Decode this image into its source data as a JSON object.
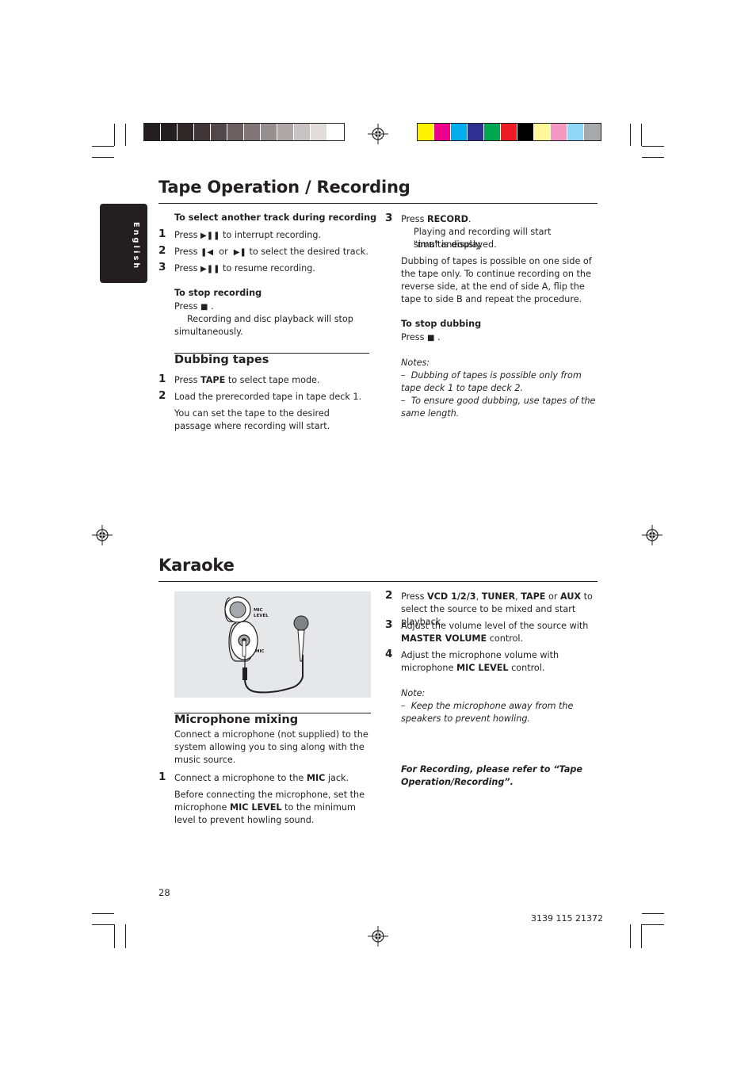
{
  "printer_marks": {
    "grayscale_swatches": [
      "#231f20",
      "#231f20",
      "#2e2627",
      "#3f3637",
      "#524849",
      "#6a6061",
      "#807677",
      "#978e8f",
      "#b0a7a8",
      "#c9c2c3",
      "#e2dddd",
      "#ffffff"
    ],
    "color_swatches": [
      "#fff200",
      "#ec008c",
      "#00aeef",
      "#2e3192",
      "#00a651",
      "#ed1c24",
      "#000000",
      "#fff799",
      "#f49ac1",
      "#8fd8f8",
      "#a7a9ac"
    ]
  },
  "sidebar": {
    "language_tab": "English"
  },
  "tape_section": {
    "title": "Tape Operation / Recording",
    "select_track": {
      "heading": "To select another track during recording",
      "steps": [
        {
          "num": "1",
          "pre": "Press",
          "icon": "play-pause",
          "post": "to interrupt recording."
        },
        {
          "num": "2",
          "pre": "Press",
          "icon1": "previous",
          "mid": "or",
          "icon2": "next",
          "post": "to select the desired track."
        },
        {
          "num": "3",
          "pre": "Press",
          "icon": "play-pause",
          "post": "to resume recording."
        }
      ]
    },
    "stop_recording": {
      "heading": "To stop recording",
      "press": "Press",
      "icon": "stop",
      "result": "Recording and disc playback will stop simultaneously."
    },
    "dubbing": {
      "heading": "Dubbing tapes",
      "step1": {
        "num": "1",
        "pre": "Press",
        "key": "TAPE",
        "post": "to select tape mode."
      },
      "step2": {
        "num": "2",
        "text": "Load the prerecorded tape in tape deck 1.",
        "extra": "You can set the tape to the desired passage where recording will start."
      }
    },
    "right_col": {
      "step3": {
        "num": "3",
        "pre": "Press",
        "key": "RECORD",
        "post": ".",
        "line2": "Playing and recording will start simultaneously.",
        "display_pre": "\"",
        "display": "DUB",
        "display_post": "\" is displayed."
      },
      "para": "Dubbing of tapes is possible on one side of the tape only. To continue recording on the reverse side, at the end of side A, flip the tape to side B and repeat the procedure.",
      "stop_dubbing": {
        "heading": "To stop dubbing",
        "press": "Press",
        "icon": "stop"
      },
      "notes": {
        "label": "Notes:",
        "items": [
          "Dubbing of tapes is possible only from tape deck 1 to tape deck 2.",
          "To ensure good dubbing, use tapes of the same length."
        ]
      }
    }
  },
  "karaoke_section": {
    "title": "Karaoke",
    "figure": {
      "label_mic_level": "MIC LEVEL",
      "label_mic": "MIC"
    },
    "mic_mixing": {
      "heading": "Microphone mixing",
      "intro": "Connect a microphone (not supplied) to the system allowing you to sing along with the music source.",
      "step1": {
        "num": "1",
        "pre": "Connect a microphone to the",
        "key": "MIC",
        "post": "jack."
      },
      "step1_extra": {
        "pre": "Before connecting the microphone, set the microphone",
        "key": "MIC LEVEL",
        "post": "to the minimum level to prevent howling sound."
      }
    },
    "right_col": {
      "step2": {
        "num": "2",
        "pre": "Press",
        "k1": "VCD 1/2/3",
        "k2": "TUNER",
        "k3": "TAPE",
        "or": "or",
        "k4": "AUX",
        "post": "to select the source to be mixed and start playback."
      },
      "step3": {
        "num": "3",
        "pre": "Adjust the volume level of the source with",
        "key": "MASTER VOLUME",
        "post": "control."
      },
      "step4": {
        "num": "4",
        "pre": "Adjust the microphone volume with microphone",
        "key": "MIC LEVEL",
        "post": "control."
      },
      "note": {
        "label": "Note:",
        "item": "Keep the microphone away from the speakers to prevent howling."
      },
      "refer": "For Recording, please refer to “Tape Operation/Recording”."
    }
  },
  "footer": {
    "page_number": "28",
    "doc_code": "3139 115 21372"
  }
}
